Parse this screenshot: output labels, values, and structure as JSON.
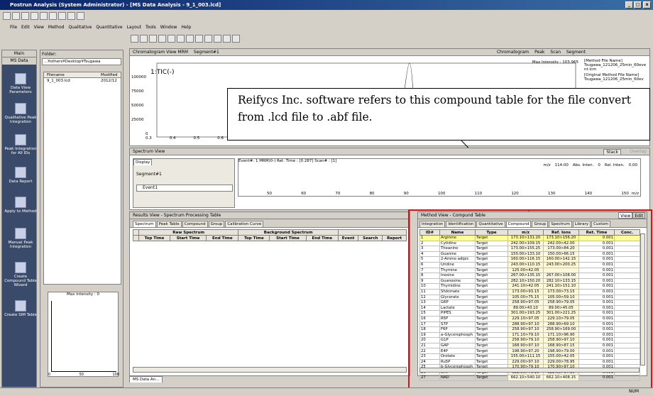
{
  "window": {
    "title": "Postrun Analysis (System Administrator) - [MS Data Analysis - 9_1_003.lcd]"
  },
  "menu": [
    "File",
    "Edit",
    "View",
    "Method",
    "Qualitative",
    "Quantitative",
    "Layout",
    "Tools",
    "Window",
    "Help"
  ],
  "sidebar": {
    "tabs": [
      "Main",
      "MS Data"
    ],
    "items": [
      "Data View Parameters",
      "Qualitative Peak Integration",
      "Peak Integration for All IDs",
      "Data Report",
      "Apply to Method",
      "Manual Peak Integration",
      "Create Compound Table Wizard",
      "Create SIM Table"
    ]
  },
  "folder": {
    "label": "Folder:",
    "path": "...¥others¥Desktop¥Tsugawa",
    "col_filename": "Filename",
    "col_modified": "Modified",
    "file": "9_1_003.lcd",
    "modified": "2012/12"
  },
  "mini_chart": {
    "title": "Max Intensity :",
    "value": "0",
    "x_ticks": [
      "0",
      "50",
      "100"
    ]
  },
  "chromatogram": {
    "title": "Chromatogram View MRM",
    "segment": "Segment#1",
    "label_chrom": "Chromatogram",
    "label_peak": "Peak",
    "label_scan": "Scan",
    "label_segment": "Segment",
    "max_intensity": "Max Intensity : 103,965",
    "trace": "1:TIC(-)",
    "y_ticks": [
      "100000",
      "75000",
      "50000",
      "25000",
      "0"
    ],
    "x_ticks": [
      "0.3",
      "0.4",
      "0.5",
      "0.6"
    ],
    "method_file_hdr": "[Method File Name]",
    "method_file": "Tsugawa_121206_25min_60event.lcm",
    "orig_method_hdr": "[Original Method File Name]",
    "orig_method": "Tsugawa_121206_25min_60ev"
  },
  "callout": "Reifycs Inc. software refers to this compound table for the file convert from .lcd file to .abf file.",
  "spectrum": {
    "title": "Spectrum View",
    "display_tab": "Display",
    "segment": "Segment#1",
    "event": "Event1",
    "stack": "Stack",
    "overlap": "Overlap",
    "info": "Event#: 1 MRM(0-)   Ret. Time : [0.287]   Scan# : [1]",
    "mz_hdr": "m/z",
    "mz_val": "114.00",
    "abs_hdr": "Abs. Inten.",
    "abs_val": "0",
    "rel_hdr": "Rel. Inten.",
    "rel_val": "0.00",
    "x_ticks": [
      "50",
      "60",
      "70",
      "80",
      "90",
      "100",
      "110",
      "120",
      "130",
      "140",
      "150"
    ],
    "x_unit": "m/z"
  },
  "results": {
    "title": "Results View - Spectrum Processing Table",
    "tabs": [
      "Spectrum",
      "Peak Table",
      "Compound",
      "Group",
      "Calibration Curve"
    ],
    "group_raw": "Raw Spectrum",
    "group_bg": "Background Spectrum",
    "cols": [
      "Top Time",
      "Start Time",
      "End Time",
      "Top Time",
      "Start Time",
      "End Time",
      "Event",
      "Search",
      "Report"
    ]
  },
  "compound_table": {
    "title": "Method View - Compund Table",
    "view_btn": "View",
    "edit_btn": "Edit",
    "tabs": [
      "Integration",
      "Identification",
      "Quantitative",
      "Compound",
      "Group",
      "Spectrum",
      "Library",
      "Custom"
    ],
    "cols": [
      "ID#",
      "Name",
      "Type",
      "m/z",
      "Ref. Ions",
      "Ret. Time",
      "Conc."
    ],
    "rows": [
      [
        "1",
        "Arginine",
        "Target",
        "173.10>131.20",
        "173.10>156.20",
        "0.001"
      ],
      [
        "2",
        "Cytidine",
        "Target",
        "242.00>109.15",
        "242.00>42.00",
        "0.001"
      ],
      [
        "3",
        "Theanine",
        "Target",
        "173.00>155.25",
        "173.00>84.20",
        "0.001"
      ],
      [
        "4",
        "Guanine",
        "Target",
        "150.00>133.10",
        "150.00>66.15",
        "0.001"
      ],
      [
        "5",
        "2-Amino adipic",
        "Target",
        "160.00>116.15",
        "160.00>142.15",
        "0.001"
      ],
      [
        "6",
        "Uridine",
        "Target",
        "243.00>110.15",
        "243.00>200.25",
        "0.001"
      ],
      [
        "7",
        "Thymine",
        "Target",
        "125.00>42.05",
        "",
        "0.001"
      ],
      [
        "8",
        "Inosine",
        "Target",
        "267.00>135.15",
        "267.00>108.00",
        "0.001"
      ],
      [
        "9",
        "Guanosine",
        "Target",
        "282.10>150.20",
        "282.10>133.15",
        "0.001"
      ],
      [
        "10",
        "Thymidine",
        "Target",
        "241.10>42.05",
        "241.10>151.10",
        "0.001"
      ],
      [
        "11",
        "Shikimate",
        "Target",
        "173.00>93.15",
        "173.00>73.15",
        "0.001"
      ],
      [
        "12",
        "Glycerate",
        "Target",
        "105.00>75.15",
        "105.00>59.10",
        "0.001"
      ],
      [
        "13",
        "G6P",
        "Target",
        "258.90>97.05",
        "258.90>79.05",
        "0.001"
      ],
      [
        "14",
        "Lactate",
        "Target",
        "89.00>43.10",
        "89.00>45.05",
        "0.001"
      ],
      [
        "15",
        "PIPES",
        "Target",
        "301.00>193.25",
        "301.00>221.25",
        "0.001"
      ],
      [
        "16",
        "R5P",
        "Target",
        "229.10>97.05",
        "229.10>79.05",
        "0.001"
      ],
      [
        "17",
        "S7P",
        "Target",
        "288.90>97.10",
        "288.90>69.10",
        "0.001"
      ],
      [
        "18",
        "F6P",
        "Target",
        "258.90>97.10",
        "258.90>169.00",
        "0.001"
      ],
      [
        "19",
        "a-Glycerophosph",
        "Target",
        "171.10>79.10",
        "171.10>96.90",
        "0.001"
      ],
      [
        "20",
        "G1P",
        "Target",
        "258.90>79.10",
        "258.90>97.10",
        "0.001"
      ],
      [
        "21",
        "GAP",
        "Target",
        "168.90>97.10",
        "168.90>87.15",
        "0.001"
      ],
      [
        "22",
        "E4P",
        "Target",
        "198.90>97.20",
        "198.90>79.00",
        "0.001"
      ],
      [
        "23",
        "Orotate",
        "Target",
        "155.00>111.15",
        "155.00>42.05",
        "0.001"
      ],
      [
        "24",
        "Ru5P",
        "Target",
        "229.00>97.10",
        "229.00>78.95",
        "0.001"
      ],
      [
        "25",
        "b-Glycerophosph",
        "Target",
        "170.90>79.10",
        "170.90>97.10",
        "0.001"
      ],
      [
        "26",
        "CMP",
        "Target",
        "322.00>79.10",
        "322.00>97.10",
        "0.001"
      ],
      [
        "27",
        "NAD",
        "Target",
        "662.10>540.10",
        "662.10>408.15",
        "0.001"
      ]
    ]
  },
  "bottom_tab": "MS Data An...",
  "status": "NUM"
}
